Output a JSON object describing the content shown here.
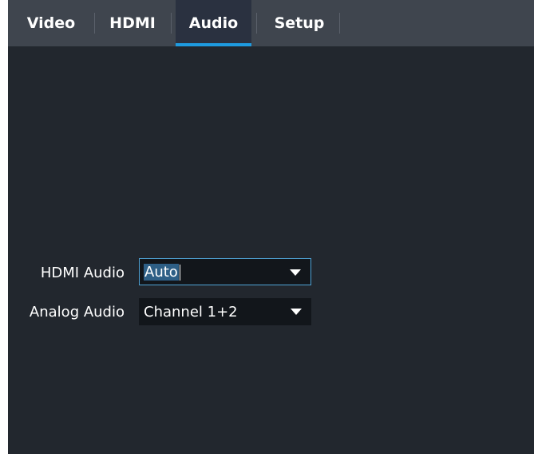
{
  "tabs": [
    {
      "label": "Video",
      "active": false
    },
    {
      "label": "HDMI",
      "active": false
    },
    {
      "label": "Audio",
      "active": true
    },
    {
      "label": "Setup",
      "active": false
    }
  ],
  "settings": {
    "hdmi_audio": {
      "label": "HDMI Audio",
      "value": "Auto"
    },
    "analog_audio": {
      "label": "Analog Audio",
      "value": "Channel 1+2"
    }
  },
  "colors": {
    "tab_active_indicator": "#1e9be0",
    "panel_background": "#22272e",
    "tabbar_background": "#3f454e",
    "focus_border": "#4fa3d6"
  },
  "icons": {
    "dropdown": "chevron-down-icon"
  }
}
